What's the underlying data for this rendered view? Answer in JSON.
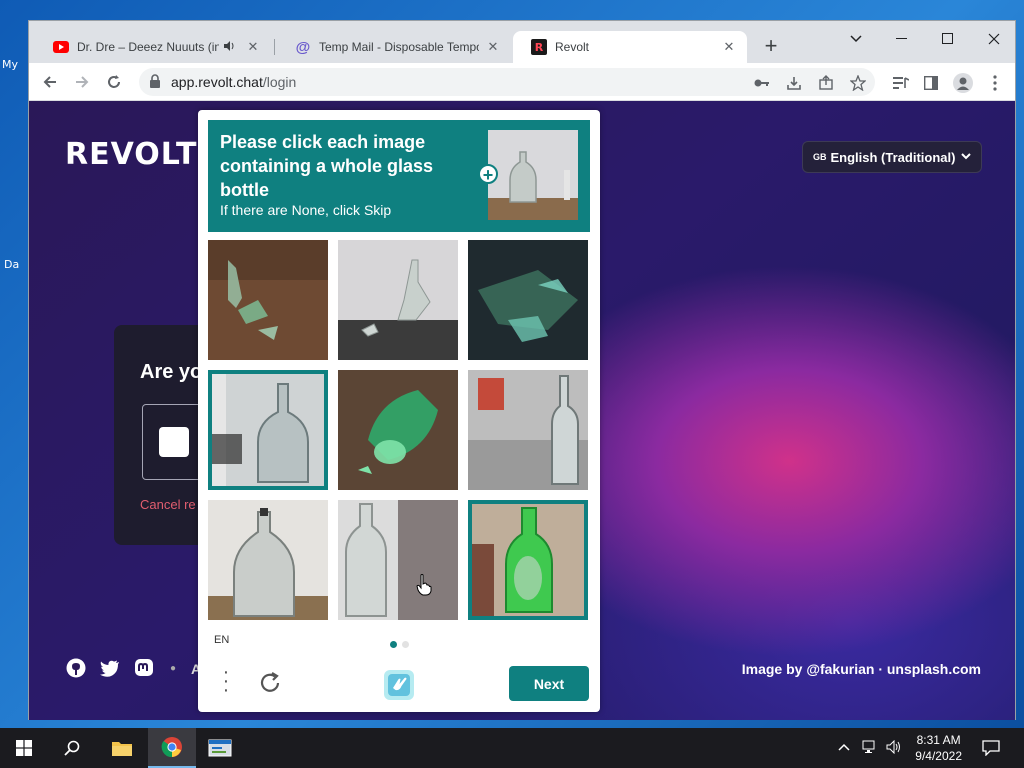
{
  "desktop": {
    "icon_labels": [
      "My",
      "Da"
    ]
  },
  "browser": {
    "tabs": [
      {
        "title": "Dr. Dre – Deeez Nuuuts (inst",
        "favicon": "youtube-icon"
      },
      {
        "title": "Temp Mail - Disposable Tempora",
        "favicon": "at-sign-icon"
      },
      {
        "title": "Revolt",
        "favicon": "revolt-icon"
      }
    ],
    "new_tab": "+",
    "url": {
      "host": "app.revolt.chat",
      "path": "/login"
    }
  },
  "page": {
    "brand": "REVOLT",
    "language": {
      "flag": "GB",
      "label": "English (Traditional)"
    },
    "login_question": "Are yo",
    "cancel_text": "Cancel re",
    "footer_letter": "A",
    "credit": "Image by @fakurian · unsplash.com"
  },
  "captcha": {
    "title": "Please click each image containing a whole glass bottle",
    "subtitle": "If there are None, click Skip",
    "language": "EN",
    "next_label": "Next",
    "selected_tiles": [
      3,
      8
    ],
    "accent": "#0f8080"
  },
  "taskbar": {
    "time": "8:31 AM",
    "date": "9/4/2022"
  }
}
